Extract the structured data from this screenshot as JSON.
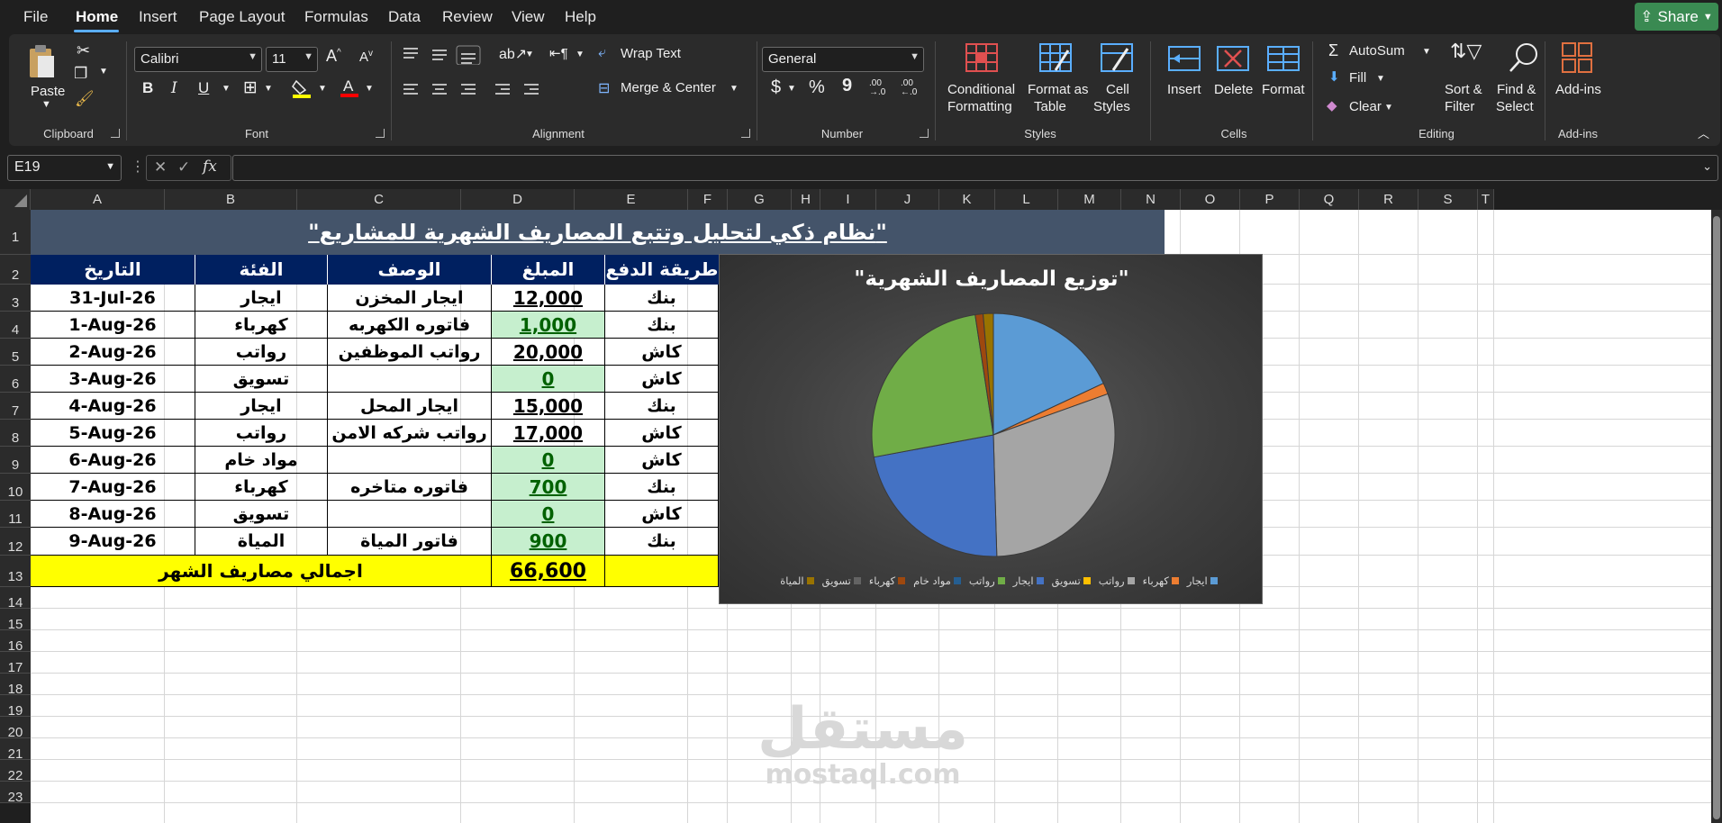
{
  "menu": {
    "tabs": [
      {
        "label": "File"
      },
      {
        "label": "Home"
      },
      {
        "label": "Insert"
      },
      {
        "label": "Page Layout"
      },
      {
        "label": "Formulas"
      },
      {
        "label": "Data"
      },
      {
        "label": "Review"
      },
      {
        "label": "View"
      },
      {
        "label": "Help"
      }
    ],
    "active_tab": "Home",
    "share_label": "Share"
  },
  "ribbon": {
    "clipboard": {
      "paste": "Paste",
      "group": "Clipboard"
    },
    "font": {
      "name": "Calibri",
      "size": "11",
      "group": "Font",
      "bold": "B",
      "italic": "I",
      "underline": "U",
      "grow": "A",
      "shrink": "A"
    },
    "alignment": {
      "wrap": "Wrap Text",
      "merge": "Merge & Center",
      "group": "Alignment"
    },
    "number": {
      "format": "General",
      "currency": "$",
      "percent": "%",
      "comma": "9",
      "inc_dec": ".00 →.0",
      "dec_dec": ".00 ←.0",
      "group": "Number"
    },
    "styles": {
      "conditional": "Conditional",
      "conditional2": "Formatting",
      "format_table": "Format as",
      "format_table2": "Table",
      "cell_styles": "Cell",
      "cell_styles2": "Styles",
      "group": "Styles"
    },
    "cells": {
      "insert": "Insert",
      "delete": "Delete",
      "format": "Format",
      "group": "Cells"
    },
    "editing": {
      "autosum": "AutoSum",
      "fill": "Fill",
      "clear": "Clear",
      "sort": "Sort &",
      "sort2": "Filter",
      "find": "Find &",
      "find2": "Select",
      "group": "Editing"
    },
    "addins": {
      "label": "Add-ins",
      "group": "Add-ins"
    },
    "colors": {
      "accent": "#5aaeff",
      "share_bg": "#3a8a52"
    }
  },
  "formula_bar": {
    "name_box": "E19",
    "fx": "fx",
    "formula": ""
  },
  "columns": [
    "A",
    "B",
    "C",
    "D",
    "E",
    "F",
    "G",
    "H",
    "I",
    "J",
    "K",
    "L",
    "M",
    "N",
    "O",
    "P",
    "Q",
    "R",
    "S",
    "T"
  ],
  "rows": [
    "1",
    "2",
    "3",
    "4",
    "5",
    "6",
    "7",
    "8",
    "9",
    "10",
    "11",
    "12",
    "13",
    "14",
    "15",
    "16",
    "17",
    "18",
    "19",
    "20",
    "21",
    "22",
    "23"
  ],
  "sheet": {
    "title": "\"نظام ذكي لتحليل وتتبع المصاريف الشهرية للمشاريع\"",
    "headers": {
      "date": "التاريخ",
      "category": "الفئة",
      "description": "الوصف",
      "amount": "المبلغ",
      "payment": "طريقة الدفع"
    },
    "rows": [
      {
        "date": "31-Jul-26",
        "category": "ايجار",
        "description": "ايجار المخزن",
        "amount": "12,000",
        "payment": "بنك",
        "green": false
      },
      {
        "date": "1-Aug-26",
        "category": "كهرباء",
        "description": "فاتوره الكهربه",
        "amount": "1,000",
        "payment": "بنك",
        "green": true
      },
      {
        "date": "2-Aug-26",
        "category": "رواتب",
        "description": "رواتب الموظفين",
        "amount": "20,000",
        "payment": "كاش",
        "green": false
      },
      {
        "date": "3-Aug-26",
        "category": "تسويق",
        "description": "",
        "amount": "0",
        "payment": "كاش",
        "green": true
      },
      {
        "date": "4-Aug-26",
        "category": "ايجار",
        "description": "ايجار المحل",
        "amount": "15,000",
        "payment": "بنك",
        "green": false
      },
      {
        "date": "5-Aug-26",
        "category": "رواتب",
        "description": "رواتب شركه الامن",
        "amount": "17,000",
        "payment": "كاش",
        "green": false
      },
      {
        "date": "6-Aug-26",
        "category": "مواد خام",
        "description": "",
        "amount": "0",
        "payment": "كاش",
        "green": true
      },
      {
        "date": "7-Aug-26",
        "category": "كهرباء",
        "description": "فاتوره متاخره",
        "amount": "700",
        "payment": "بنك",
        "green": true
      },
      {
        "date": "8-Aug-26",
        "category": "تسويق",
        "description": "",
        "amount": "0",
        "payment": "كاش",
        "green": true
      },
      {
        "date": "9-Aug-26",
        "category": "المياة",
        "description": "فاتور المياة",
        "amount": "900",
        "payment": "بنك",
        "green": true
      }
    ],
    "total_label": "اجمالي مصاريف الشهر",
    "total_value": "66,600"
  },
  "chart_data": {
    "type": "pie",
    "title": "\"توزيع المصاريف الشهرية\"",
    "categories": [
      "ايجار",
      "كهرباء",
      "رواتب",
      "تسويق",
      "ايجار",
      "رواتب",
      "مواد خام",
      "كهرباء",
      "تسويق",
      "المياة"
    ],
    "values": [
      12000,
      1000,
      20000,
      0,
      15000,
      17000,
      0,
      700,
      0,
      900
    ],
    "colors": [
      "#5b9bd5",
      "#ed7d31",
      "#a5a5a5",
      "#ffc000",
      "#4472c4",
      "#70ad47",
      "#255e91",
      "#9e480e",
      "#636363",
      "#997300"
    ],
    "legend_position": "bottom"
  },
  "watermark": {
    "arabic": "مستقل",
    "latin": "mostaql.com"
  }
}
